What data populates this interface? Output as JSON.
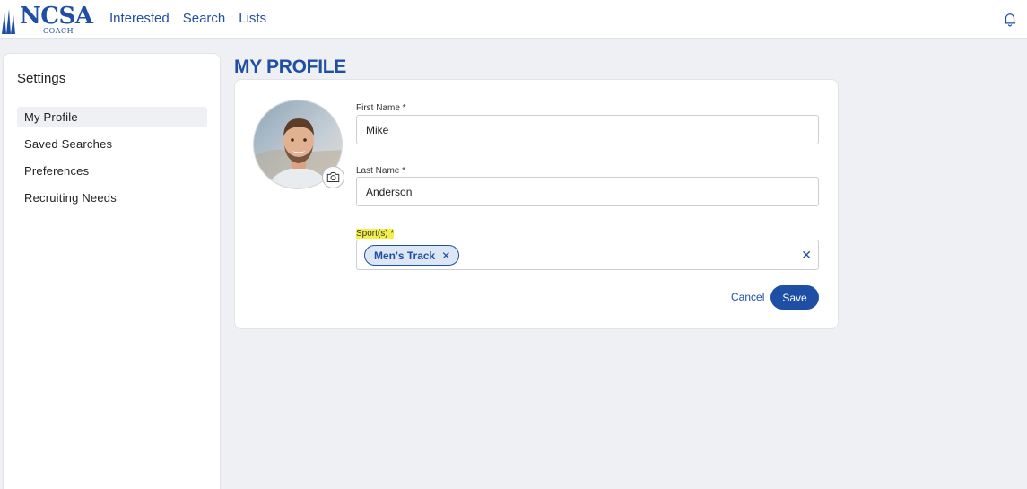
{
  "brand": {
    "name": "NCSA",
    "sub": "COACH",
    "color": "#1f4fa5"
  },
  "nav": {
    "items": [
      "Interested",
      "Search",
      "Lists"
    ],
    "bell_icon": "bell-icon"
  },
  "sidebar": {
    "title": "Settings",
    "items": [
      "My Profile",
      "Saved Searches",
      "Preferences",
      "Recruiting Needs"
    ],
    "active": "My Profile"
  },
  "page": {
    "title": "MY PROFILE"
  },
  "profile": {
    "camera_icon": "camera-icon",
    "first_name_label": "First Name *",
    "first_name_value": "Mike",
    "last_name_label": "Last Name *",
    "last_name_value": "Anderson",
    "sports_label": "Sport(s) *",
    "sports_selected": [
      "Men's Track"
    ],
    "chip_remove_icon": "close-icon",
    "clear_icon": "close-icon",
    "cancel_label": "Cancel",
    "save_label": "Save"
  }
}
